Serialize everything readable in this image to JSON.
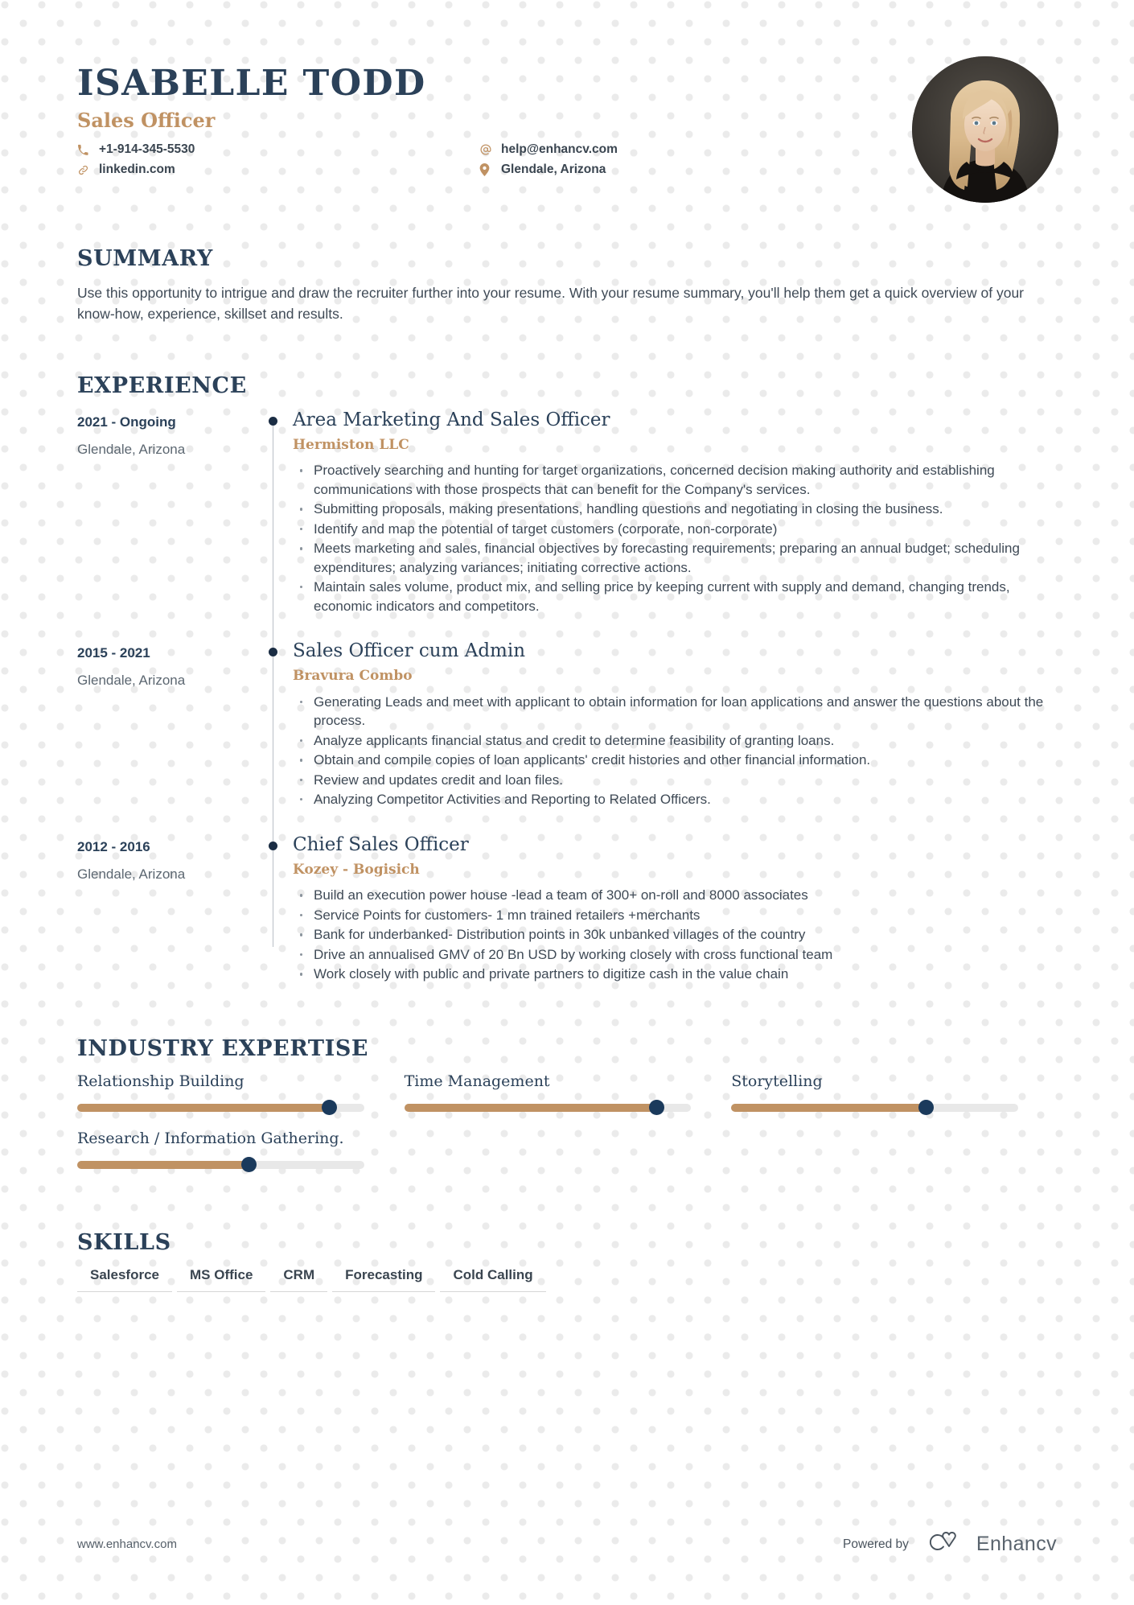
{
  "header": {
    "name": "ISABELLE TODD",
    "role": "Sales Officer",
    "contacts": {
      "phone": "+1-914-345-5530",
      "email": "help@enhancv.com",
      "linkedin": "linkedin.com",
      "location": "Glendale, Arizona"
    },
    "avatar_alt": "profile-photo"
  },
  "summary": {
    "title": "SUMMARY",
    "text": "Use this opportunity to intrigue and draw the recruiter further into your resume. With your resume summary, you'll help them get a quick overview of your know-how, experience, skillset and results."
  },
  "experience": {
    "title": "EXPERIENCE",
    "items": [
      {
        "dates": "2021 - Ongoing",
        "location": "Glendale, Arizona",
        "title": "Area Marketing And Sales Officer",
        "company": "Hermiston LLC",
        "bullets": [
          "Proactively searching and hunting for target organizations, concerned decision making authority and establishing communications with those prospects that can benefit for the Company's services.",
          "Submitting proposals, making presentations, handling questions and negotiating in closing the business.",
          "Identify and map the potential of target customers (corporate, non-corporate)",
          "Meets marketing and sales, financial objectives by forecasting requirements; preparing an annual budget; scheduling expenditures; analyzing variances; initiating corrective actions.",
          "Maintain sales volume, product mix, and selling price by keeping current with supply and demand, changing trends, economic indicators and competitors."
        ]
      },
      {
        "dates": "2015 - 2021",
        "location": "Glendale, Arizona",
        "title": "Sales Officer cum Admin",
        "company": "Bravura Combo",
        "bullets": [
          "Generating Leads and meet with applicant to obtain information for loan applications and answer the questions about the process.",
          "Analyze applicants financial status and credit to determine feasibility of granting loans.",
          "Obtain and compile copies of loan applicants' credit histories and other financial information.",
          "Review and updates credit and loan files.",
          "Analyzing Competitor Activities and Reporting to Related Officers."
        ]
      },
      {
        "dates": "2012 - 2016",
        "location": "Glendale, Arizona",
        "title": "Chief Sales Officer",
        "company": "Kozey - Bogisich",
        "bullets": [
          "Build an execution power house -lead a team of 300+ on-roll and 8000 associates",
          "Service Points for customers- 1 mn trained retailers +merchants",
          " Bank for underbanked- Distribution points in 30k unbanked villages of the country",
          "Drive an annualised GMV of 20 Bn USD by working closely with cross functional team",
          " Work closely with public and private partners to digitize cash in the value chain"
        ]
      }
    ]
  },
  "expertise": {
    "title": "INDUSTRY EXPERTISE",
    "items": [
      {
        "label": "Relationship Building",
        "value": 88
      },
      {
        "label": "Time Management",
        "value": 88
      },
      {
        "label": "Storytelling",
        "value": 68
      },
      {
        "label": "Research / Information Gathering.",
        "value": 60
      }
    ]
  },
  "skills": {
    "title": "SKILLS",
    "items": [
      "Salesforce",
      "MS Office",
      "CRM",
      "Forecasting",
      "Cold Calling"
    ]
  },
  "footer": {
    "url": "www.enhancv.com",
    "powered_by": "Powered by",
    "brand": "Enhancv"
  },
  "colors": {
    "navy": "#2b4159",
    "gold": "#c09263",
    "body": "#3f4a56",
    "track": "#e8e8e8",
    "knob": "#1b3a5c"
  }
}
